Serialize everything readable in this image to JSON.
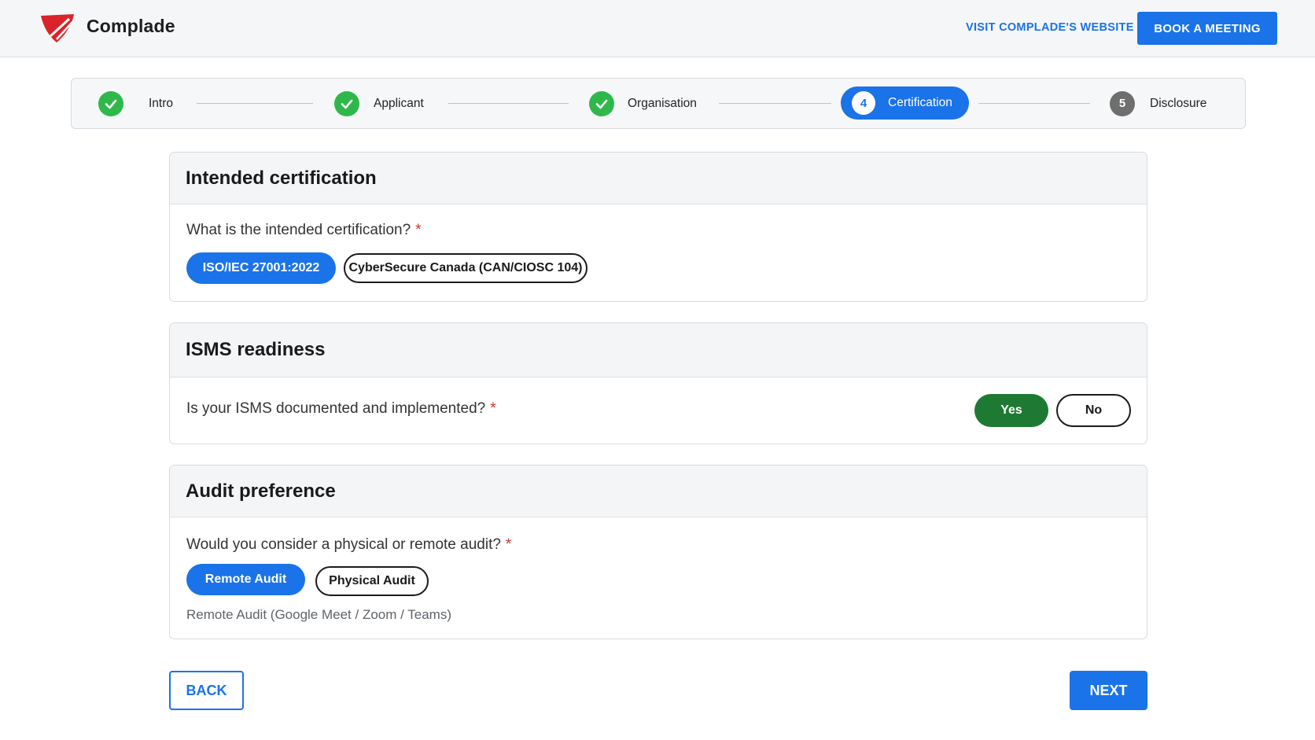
{
  "header": {
    "brand": "Complade",
    "logo_icon": "shield-logo-icon",
    "visit_link": "VISIT COMPLADE'S WEBSITE",
    "book_button": "BOOK A MEETING"
  },
  "stepper": {
    "steps": [
      {
        "label": "Intro",
        "state": "done"
      },
      {
        "label": "Applicant",
        "state": "done"
      },
      {
        "label": "Organisation",
        "state": "done"
      },
      {
        "label": "Certification",
        "number": "4",
        "state": "active"
      },
      {
        "label": "Disclosure",
        "number": "5",
        "state": "todo"
      }
    ]
  },
  "sections": {
    "certification": {
      "title": "Intended certification",
      "question": "What is the intended certification?",
      "required_mark": "*",
      "options": [
        "ISO/IEC 27001:2022",
        "CyberSecure Canada (CAN/CIOSC 104)"
      ],
      "selected": "ISO/IEC 27001:2022"
    },
    "isms": {
      "title": "ISMS readiness",
      "question": "Is your ISMS documented and implemented?",
      "required_mark": "*",
      "yes_label": "Yes",
      "no_label": "No",
      "selected": "Yes"
    },
    "audit": {
      "title": "Audit preference",
      "question": "Would you consider a physical or remote audit?",
      "required_mark": "*",
      "options": [
        "Remote Audit",
        "Physical Audit"
      ],
      "selected": "Remote Audit",
      "note": "Remote Audit (Google Meet / Zoom / Teams)"
    }
  },
  "footer": {
    "back_label": "BACK",
    "next_label": "NEXT"
  },
  "colors": {
    "primary": "#1a73e8",
    "success": "#2fb84a",
    "yes_selected": "#1e7a32",
    "required": "#d93025",
    "brand_red": "#d9242b"
  }
}
